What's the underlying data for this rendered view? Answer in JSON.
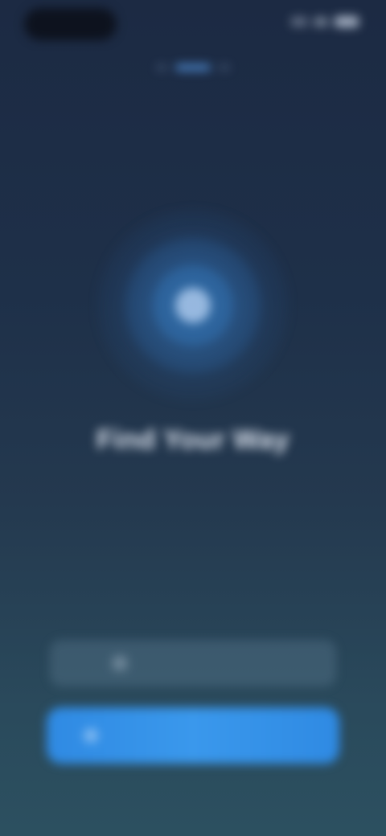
{
  "status_bar": {
    "time": "",
    "icons": [
      "signal-icon",
      "wifi-icon",
      "battery-icon"
    ]
  },
  "progress": {
    "total_steps": 3,
    "current_step": 2
  },
  "hero": {
    "icon": "location-pin-icon"
  },
  "title": "Find Your Way",
  "subtitle": "",
  "buttons": {
    "secondary_label": "",
    "primary_label": ""
  },
  "colors": {
    "background_top": "#1c2a43",
    "background_bottom": "#2c5060",
    "accent": "#3a98ec"
  }
}
